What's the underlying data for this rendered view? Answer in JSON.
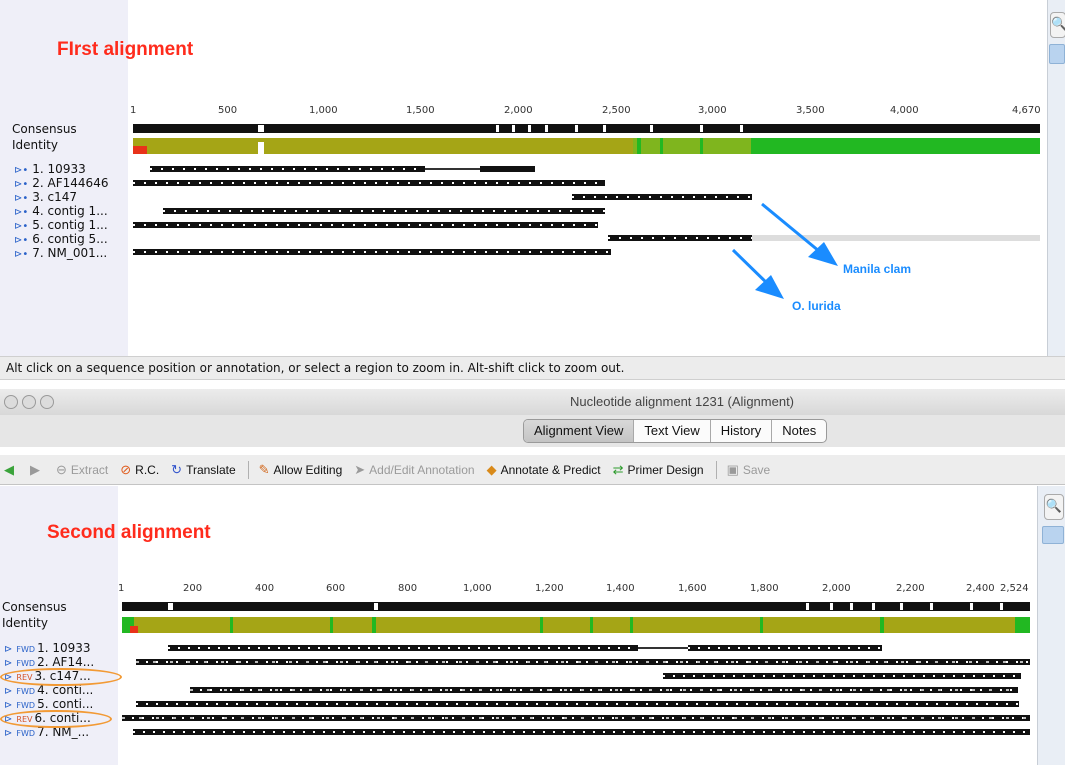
{
  "top": {
    "title": "FIrst alignment",
    "ruler": [
      "1",
      "500",
      "1,000",
      "1,500",
      "2,000",
      "2,500",
      "3,000",
      "3,500",
      "4,000",
      "4,670"
    ],
    "consensus_label": "Consensus",
    "identity_label": "Identity",
    "sequences": [
      "1. 10933",
      "2. AF144646",
      "3. c147",
      "4. contig 1...",
      "5. contig 1...",
      "6. contig 5...",
      "7. NM_001..."
    ],
    "annotation_manila": "Manila clam",
    "annotation_olurida": "O. lurida"
  },
  "status_text": "Alt click on a sequence position or annotation, or select a region to zoom in. Alt-shift click to zoom out.",
  "window": {
    "title": "Nucleotide alignment 1231 (Alignment)"
  },
  "tabs": [
    "Alignment View",
    "Text View",
    "History",
    "Notes"
  ],
  "toolbar": {
    "extract": "Extract",
    "rc": "R.C.",
    "translate": "Translate",
    "allow_editing": "Allow Editing",
    "add_edit_annotation": "Add/Edit Annotation",
    "annotate_predict": "Annotate & Predict",
    "primer_design": "Primer Design",
    "save": "Save"
  },
  "bottom": {
    "title": "Second alignment",
    "ruler": [
      "1",
      "200",
      "400",
      "600",
      "800",
      "1,000",
      "1,200",
      "1,400",
      "1,600",
      "1,800",
      "2,000",
      "2,200",
      "2,400",
      "2,524"
    ],
    "consensus_label": "Consensus",
    "identity_label": "Identity",
    "sequences": [
      {
        "dir": "FWD",
        "label": "1. 10933"
      },
      {
        "dir": "FWD",
        "label": "2. AF14..."
      },
      {
        "dir": "REV",
        "label": "3. c147..."
      },
      {
        "dir": "FWD",
        "label": "4. conti..."
      },
      {
        "dir": "FWD",
        "label": "5. conti..."
      },
      {
        "dir": "REV",
        "label": "6. conti..."
      },
      {
        "dir": "FWD",
        "label": "7. NM_..."
      }
    ]
  },
  "colors": {
    "title_red": "#ff2b1c",
    "annotation_blue": "#1a8cff",
    "identity_olive": "#a5a516",
    "identity_green": "#22b822",
    "highlight_orange": "#f29a35"
  }
}
